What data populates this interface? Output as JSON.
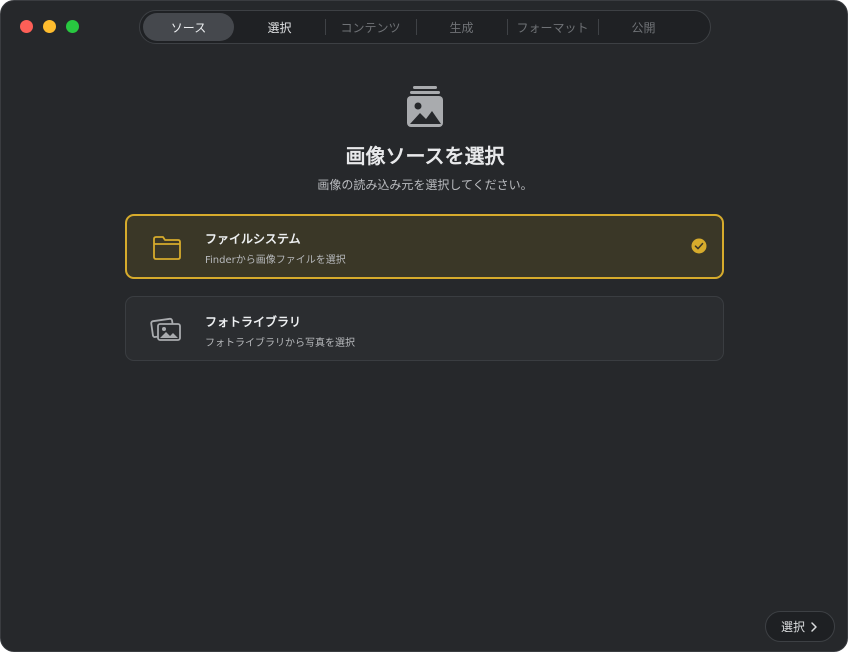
{
  "window": {
    "tabs": [
      {
        "label": "ソース",
        "state": "active"
      },
      {
        "label": "選択",
        "state": "next"
      },
      {
        "label": "コンテンツ",
        "state": "disabled"
      },
      {
        "label": "生成",
        "state": "disabled"
      },
      {
        "label": "フォーマット",
        "state": "disabled"
      },
      {
        "label": "公開",
        "state": "disabled"
      }
    ]
  },
  "hero": {
    "icon": "photo-stack-icon",
    "title": "画像ソースを選択",
    "subtitle": "画像の読み込み元を選択してください。"
  },
  "options": [
    {
      "icon": "folder-icon",
      "title": "ファイルシステム",
      "description": "Finderから画像ファイルを選択",
      "selected": true
    },
    {
      "icon": "photos-icon",
      "title": "フォトライブラリ",
      "description": "フォトライブラリから写真を選択",
      "selected": false
    }
  ],
  "footer": {
    "select_label": "選択",
    "select_icon": "chevron-right-icon"
  },
  "colors": {
    "background": "#26282b",
    "accent": "#d6ab2c",
    "selected_fill": "#3a3727"
  }
}
